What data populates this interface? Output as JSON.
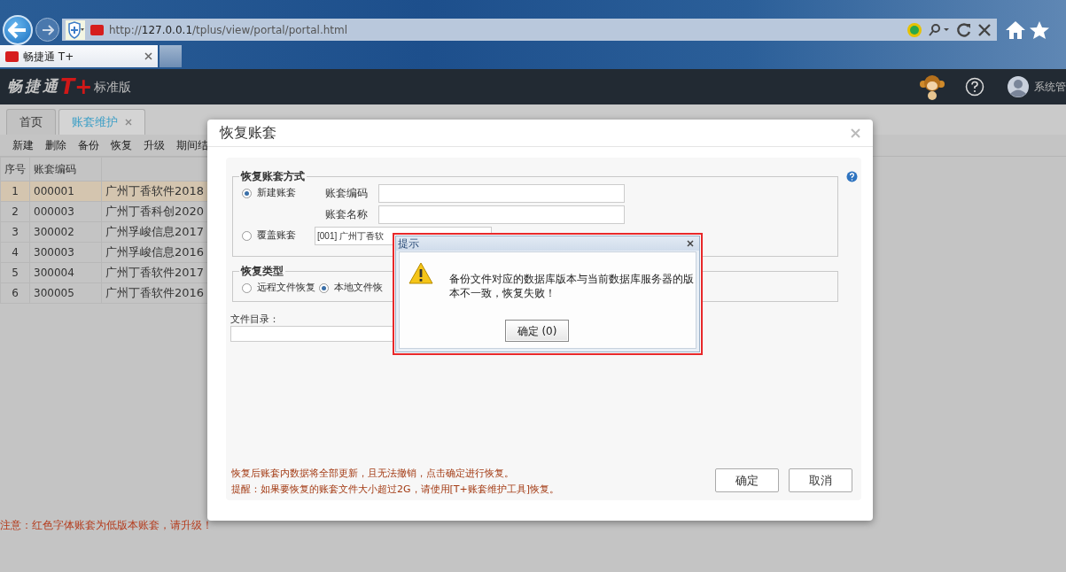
{
  "browser": {
    "url": "http://**127.0.0.1**/tplus/view/portal/portal.html",
    "tab_title": "畅捷通 T+"
  },
  "app_header": {
    "logo_text": "畅捷通",
    "logo_mark": "T+",
    "edition": "标准版",
    "user": "系统管"
  },
  "tabs": [
    {
      "label": "首页",
      "selected": false
    },
    {
      "label": "账套维护",
      "selected": true
    }
  ],
  "toolbar": [
    "新建",
    "删除",
    "备份",
    "恢复",
    "升级",
    "期间结"
  ],
  "table": {
    "columns": [
      "序号",
      "账套编码"
    ],
    "rows": [
      {
        "cells": [
          "1",
          "000001",
          "广州丁香软件2018"
        ],
        "selected": true
      },
      {
        "cells": [
          "2",
          "000003",
          "广州丁香科创2020"
        ],
        "selected": false
      },
      {
        "cells": [
          "3",
          "300002",
          "广州孚峻信息2017"
        ],
        "selected": false
      },
      {
        "cells": [
          "4",
          "300003",
          "广州孚峻信息2016"
        ],
        "selected": false
      },
      {
        "cells": [
          "5",
          "300004",
          "广州丁香软件2017"
        ],
        "selected": false
      },
      {
        "cells": [
          "6",
          "300005",
          "广州丁香软件2016"
        ],
        "selected": false
      }
    ]
  },
  "notice": "注意：红色字体账套为低版本账套，请升级！",
  "restore_dialog": {
    "title": "恢复账套",
    "method_group": {
      "legend": "恢复账套方式",
      "options": [
        {
          "label": "新建账套",
          "selected": true
        },
        {
          "label": "覆盖账套",
          "selected": false
        }
      ],
      "fields": [
        "账套编码",
        "账套名称"
      ],
      "cover_value": "[001] 广州丁香软"
    },
    "type_group": {
      "legend": "恢复类型",
      "options": [
        {
          "label": "远程文件恢复",
          "selected": false
        },
        {
          "label": "本地文件恢",
          "selected": true
        }
      ]
    },
    "dir_label": "文件目录：",
    "notes": [
      "恢复后账套内数据将全部更新，且无法撤销，点击确定进行恢复。",
      "提醒：如果要恢复的账套文件大小超过2G，请使用[T+账套维护工具]恢复。"
    ],
    "buttons": [
      "确定",
      "取消"
    ]
  },
  "alert": {
    "title": "提示",
    "message": "备份文件对应的数据库版本与当前数据库服务器的版本不一致，恢复失败！",
    "button": "确定 (0)"
  }
}
